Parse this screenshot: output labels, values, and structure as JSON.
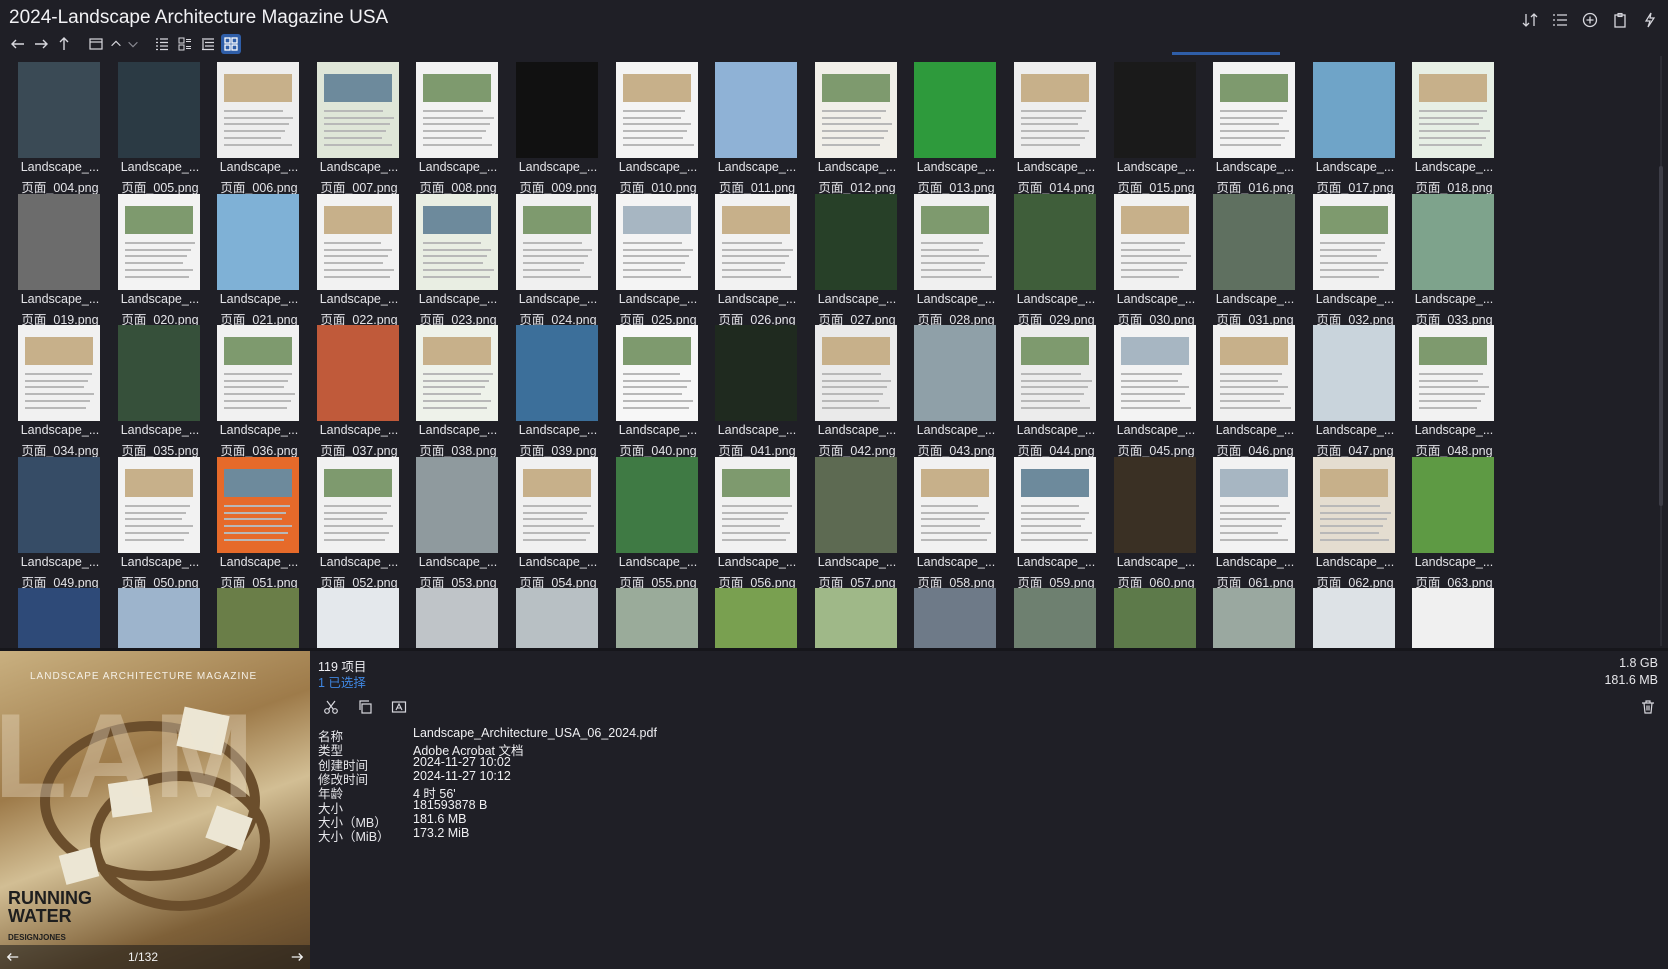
{
  "window": {
    "title": "2024-Landscape Architecture Magazine USA"
  },
  "toolbar": {
    "right_icons": [
      "sort-icon",
      "details-view-icon",
      "add-circle-icon",
      "clipboard-icon",
      "pin-icon"
    ],
    "nav_icons": [
      "back-arrow-icon",
      "forward-arrow-icon",
      "up-arrow-icon",
      "window-icon",
      "chevron-up-icon",
      "chevron-down-icon",
      "list-view-icon",
      "tiles-view-icon",
      "tree-view-icon",
      "thumbnail-view-icon"
    ]
  },
  "files": [
    {
      "name": "Landscape_...",
      "sub": "页面_004.png"
    },
    {
      "name": "Landscape_...",
      "sub": "页面_005.png"
    },
    {
      "name": "Landscape_...",
      "sub": "页面_006.png"
    },
    {
      "name": "Landscape_...",
      "sub": "页面_007.png"
    },
    {
      "name": "Landscape_...",
      "sub": "页面_008.png"
    },
    {
      "name": "Landscape_...",
      "sub": "页面_009.png"
    },
    {
      "name": "Landscape_...",
      "sub": "页面_010.png"
    },
    {
      "name": "Landscape_...",
      "sub": "页面_011.png"
    },
    {
      "name": "Landscape_...",
      "sub": "页面_012.png"
    },
    {
      "name": "Landscape_...",
      "sub": "页面_013.png"
    },
    {
      "name": "Landscape_...",
      "sub": "页面_014.png"
    },
    {
      "name": "Landscape_...",
      "sub": "页面_015.png"
    },
    {
      "name": "Landscape_...",
      "sub": "页面_016.png"
    },
    {
      "name": "Landscape_...",
      "sub": "页面_017.png"
    },
    {
      "name": "Landscape_...",
      "sub": "页面_018.png"
    },
    {
      "name": "Landscape_...",
      "sub": "页面_019.png"
    },
    {
      "name": "Landscape_...",
      "sub": "页面_020.png"
    },
    {
      "name": "Landscape_...",
      "sub": "页面_021.png"
    },
    {
      "name": "Landscape_...",
      "sub": "页面_022.png"
    },
    {
      "name": "Landscape_...",
      "sub": "页面_023.png"
    },
    {
      "name": "Landscape_...",
      "sub": "页面_024.png"
    },
    {
      "name": "Landscape_...",
      "sub": "页面_025.png"
    },
    {
      "name": "Landscape_...",
      "sub": "页面_026.png"
    },
    {
      "name": "Landscape_...",
      "sub": "页面_027.png"
    },
    {
      "name": "Landscape_...",
      "sub": "页面_028.png"
    },
    {
      "name": "Landscape_...",
      "sub": "页面_029.png"
    },
    {
      "name": "Landscape_...",
      "sub": "页面_030.png"
    },
    {
      "name": "Landscape_...",
      "sub": "页面_031.png"
    },
    {
      "name": "Landscape_...",
      "sub": "页面_032.png"
    },
    {
      "name": "Landscape_...",
      "sub": "页面_033.png"
    },
    {
      "name": "Landscape_...",
      "sub": "页面_034.png"
    },
    {
      "name": "Landscape_...",
      "sub": "页面_035.png"
    },
    {
      "name": "Landscape_...",
      "sub": "页面_036.png"
    },
    {
      "name": "Landscape_...",
      "sub": "页面_037.png"
    },
    {
      "name": "Landscape_...",
      "sub": "页面_038.png"
    },
    {
      "name": "Landscape_...",
      "sub": "页面_039.png"
    },
    {
      "name": "Landscape_...",
      "sub": "页面_040.png"
    },
    {
      "name": "Landscape_...",
      "sub": "页面_041.png"
    },
    {
      "name": "Landscape_...",
      "sub": "页面_042.png"
    },
    {
      "name": "Landscape_...",
      "sub": "页面_043.png"
    },
    {
      "name": "Landscape_...",
      "sub": "页面_044.png"
    },
    {
      "name": "Landscape_...",
      "sub": "页面_045.png"
    },
    {
      "name": "Landscape_...",
      "sub": "页面_046.png"
    },
    {
      "name": "Landscape_...",
      "sub": "页面_047.png"
    },
    {
      "name": "Landscape_...",
      "sub": "页面_048.png"
    },
    {
      "name": "Landscape_...",
      "sub": "页面_049.png"
    },
    {
      "name": "Landscape_...",
      "sub": "页面_050.png"
    },
    {
      "name": "Landscape_...",
      "sub": "页面_051.png"
    },
    {
      "name": "Landscape_...",
      "sub": "页面_052.png"
    },
    {
      "name": "Landscape_...",
      "sub": "页面_053.png"
    },
    {
      "name": "Landscape_...",
      "sub": "页面_054.png"
    },
    {
      "name": "Landscape_...",
      "sub": "页面_055.png"
    },
    {
      "name": "Landscape_...",
      "sub": "页面_056.png"
    },
    {
      "name": "Landscape_...",
      "sub": "页面_057.png"
    },
    {
      "name": "Landscape_...",
      "sub": "页面_058.png"
    },
    {
      "name": "Landscape_...",
      "sub": "页面_059.png"
    },
    {
      "name": "Landscape_...",
      "sub": "页面_060.png"
    },
    {
      "name": "Landscape_...",
      "sub": "页面_061.png"
    },
    {
      "name": "Landscape_...",
      "sub": "页面_062.png"
    },
    {
      "name": "Landscape_...",
      "sub": "页面_063.png"
    }
  ],
  "thumb_colors": [
    "#3a4a55",
    "#2b3a44",
    "#eeeeee",
    "#dfe6d8",
    "#f2f2f2",
    "#111111",
    "#f4f4f4",
    "#8fb2d6",
    "#f1efe9",
    "#2e9a3c",
    "#eeeeee",
    "#1a1a1a",
    "#f3f3f3",
    "#6fa4c8",
    "#e7efe5",
    "#6c6c6c",
    "#f3f3f3",
    "#7fb1d6",
    "#f2f2f2",
    "#e9eee3",
    "#f0f0f0",
    "#f4f4f4",
    "#f2f2f2",
    "#274028",
    "#f0f0f0",
    "#3f5e3a",
    "#f1f1f1",
    "#5f7060",
    "#f1f1f1",
    "#7ea38c",
    "#f1f1f1",
    "#36503a",
    "#f1f1f1",
    "#c05a3a",
    "#eef2ea",
    "#3c6f9a",
    "#f7f7f7",
    "#1f2a1f",
    "#eaeaea",
    "#8fa0a8",
    "#ececec",
    "#f3f3f3",
    "#f0f0f0",
    "#c9d4dc",
    "#f2f2f2",
    "#364c66",
    "#f2f2f2",
    "#e66a2a",
    "#f1f1f1",
    "#8f9a9e",
    "#f0f0f0",
    "#3f7a44",
    "#f1f1f1",
    "#5d6a52",
    "#f1f1f1",
    "#f2f2f2",
    "#3a3024",
    "#f2f2f2",
    "#e4ddd0",
    "#5e9a44"
  ],
  "partial_row_colors": [
    "#2e4a78",
    "#9db4cc",
    "#6a7e48",
    "#e4e8ec",
    "#bfc4c8",
    "#b8c0c4",
    "#9aab9a",
    "#79a050",
    "#9fb888",
    "#6e7a88",
    "#6e8070",
    "#5d7a4a",
    "#9aa8a0",
    "#dde2e6",
    "#f0f0f0"
  ],
  "preview": {
    "magazine_title": "LANDSCAPE ARCHITECTURE MAGAZINE",
    "masthead": "LAM",
    "headline": "RUNNING WATER",
    "design_credit": "DESIGNJONES",
    "page_indicator": "1/132"
  },
  "details": {
    "item_count": "119 项目",
    "selected": "1 已选择",
    "total_size": "1.8 GB",
    "selected_size": "181.6 MB",
    "action_icons": [
      "cut-icon",
      "copy-icon",
      "rename-icon"
    ],
    "properties": [
      {
        "key": "名称",
        "value": "Landscape_Architecture_USA_06_2024.pdf"
      },
      {
        "key": "类型",
        "value": "Adobe Acrobat 文档"
      },
      {
        "key": "创建时间",
        "value": "2024-11-27  10:02"
      },
      {
        "key": "修改时间",
        "value": "2024-11-27  10:12"
      },
      {
        "key": "年龄",
        "value": "4 时 56'"
      },
      {
        "key": "大小",
        "value": "181593878 B"
      },
      {
        "key": "大小（MB）",
        "value": "181.6 MB"
      },
      {
        "key": "大小（MiB）",
        "value": "173.2 MiB"
      }
    ]
  }
}
